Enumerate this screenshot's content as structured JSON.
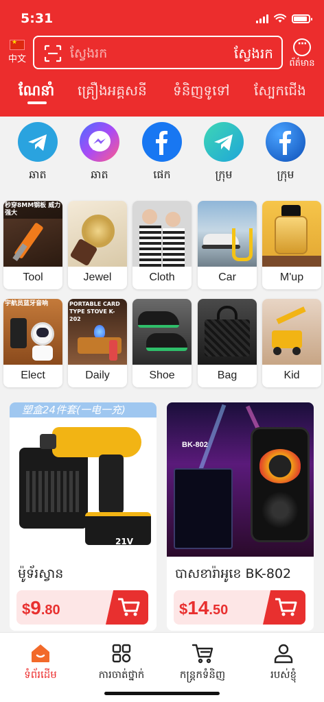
{
  "status": {
    "time": "5:31"
  },
  "header": {
    "lang_label": "中文",
    "search_placeholder": "ស្វែងរក",
    "search_button": "ស្វែងរក",
    "more_label": "ព័ត៌មាន",
    "colors": {
      "primary": "#ec2d2d"
    }
  },
  "tabs": [
    {
      "label": "ណែនាំ"
    },
    {
      "label": "គ្រឿងអគ្គសនី"
    },
    {
      "label": "ទំនិញទូទៅ"
    },
    {
      "label": "ស្បែកជើង"
    }
  ],
  "social": [
    {
      "label": "ឆាត",
      "icon": "telegram-icon"
    },
    {
      "label": "ឆាត",
      "icon": "messenger-icon"
    },
    {
      "label": "ផេក",
      "icon": "facebook-icon"
    },
    {
      "label": "ក្រុម",
      "icon": "telegram-icon"
    },
    {
      "label": "ក្រុម",
      "icon": "facebook-icon"
    }
  ],
  "categories": [
    {
      "label": "Tool",
      "banner": "秒穿8MM钢板 威力强大"
    },
    {
      "label": "Jewel",
      "banner": ""
    },
    {
      "label": "Cloth",
      "banner": ""
    },
    {
      "label": "Car",
      "banner": ""
    },
    {
      "label": "M'up",
      "banner": ""
    },
    {
      "label": "Elect",
      "banner": "宇航员蓝牙音响"
    },
    {
      "label": "Daily",
      "banner": "PORTABLE CARD TYPE STOVE K-202"
    },
    {
      "label": "Shoe",
      "banner": ""
    },
    {
      "label": "Bag",
      "banner": ""
    },
    {
      "label": "Kid",
      "banner": ""
    }
  ],
  "products": [
    {
      "name": "ម៉ូទ័រស្វាន",
      "banner": "塑盒24件套(一电一充)",
      "price": {
        "currency": "$",
        "integer": "9",
        "decimal": ".80"
      },
      "image_badge": "21V"
    },
    {
      "name": "បាសខារ៉ាអូខេ BK-802",
      "banner": "",
      "price": {
        "currency": "$",
        "integer": "14",
        "decimal": ".50"
      },
      "image_badge": "BK-802"
    }
  ],
  "bottom_nav": [
    {
      "label": "ទំព័រដើម",
      "icon": "home-icon",
      "active": true
    },
    {
      "label": "ការចាត់ថ្នាក់",
      "icon": "grid-icon",
      "active": false
    },
    {
      "label": "កន្ត្រកទំនិញ",
      "icon": "cart-icon",
      "active": false
    },
    {
      "label": "របស់ខ្ញុំ",
      "icon": "user-icon",
      "active": false
    }
  ]
}
